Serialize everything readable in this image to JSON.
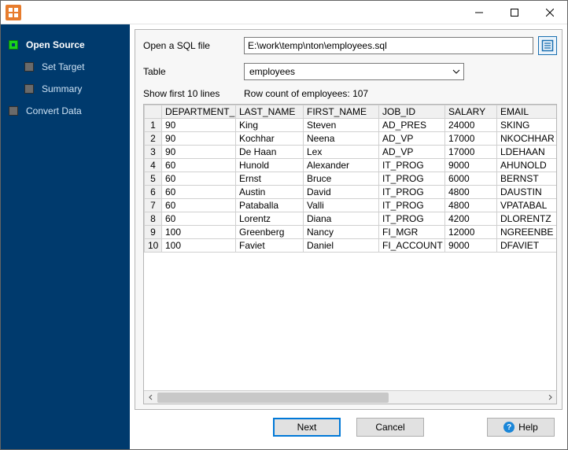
{
  "sidebar": {
    "items": [
      {
        "label": "Open Source",
        "active": true,
        "current": true
      },
      {
        "label": "Set Target"
      },
      {
        "label": "Summary"
      },
      {
        "label": "Convert Data"
      }
    ]
  },
  "form": {
    "open_file_label": "Open a SQL file",
    "file_value": "E:\\work\\temp\\nton\\employees.sql",
    "table_label": "Table",
    "table_value": "employees"
  },
  "info": {
    "show_first": "Show first 10 lines",
    "row_count": "Row count of employees: 107"
  },
  "table": {
    "headers": [
      "DEPARTMENT_ID",
      "LAST_NAME",
      "FIRST_NAME",
      "JOB_ID",
      "SALARY",
      "EMAIL"
    ],
    "rows": [
      {
        "n": "1",
        "cells": [
          "90",
          "King",
          "Steven",
          "AD_PRES",
          "24000",
          "SKING"
        ]
      },
      {
        "n": "2",
        "cells": [
          "90",
          "Kochhar",
          "Neena",
          "AD_VP",
          "17000",
          "NKOCHHAR"
        ]
      },
      {
        "n": "3",
        "cells": [
          "90",
          "De Haan",
          "Lex",
          "AD_VP",
          "17000",
          "LDEHAAN"
        ]
      },
      {
        "n": "4",
        "cells": [
          "60",
          "Hunold",
          "Alexander",
          "IT_PROG",
          "9000",
          "AHUNOLD"
        ]
      },
      {
        "n": "5",
        "cells": [
          "60",
          "Ernst",
          "Bruce",
          "IT_PROG",
          "6000",
          "BERNST"
        ]
      },
      {
        "n": "6",
        "cells": [
          "60",
          "Austin",
          "David",
          "IT_PROG",
          "4800",
          "DAUSTIN"
        ]
      },
      {
        "n": "7",
        "cells": [
          "60",
          "Pataballa",
          "Valli",
          "IT_PROG",
          "4800",
          "VPATABAL"
        ]
      },
      {
        "n": "8",
        "cells": [
          "60",
          "Lorentz",
          "Diana",
          "IT_PROG",
          "4200",
          "DLORENTZ"
        ]
      },
      {
        "n": "9",
        "cells": [
          "100",
          "Greenberg",
          "Nancy",
          "FI_MGR",
          "12000",
          "NGREENBE"
        ]
      },
      {
        "n": "10",
        "cells": [
          "100",
          "Faviet",
          "Daniel",
          "FI_ACCOUNT",
          "9000",
          "DFAVIET"
        ]
      }
    ]
  },
  "buttons": {
    "next": "Next",
    "cancel": "Cancel",
    "help": "Help"
  }
}
